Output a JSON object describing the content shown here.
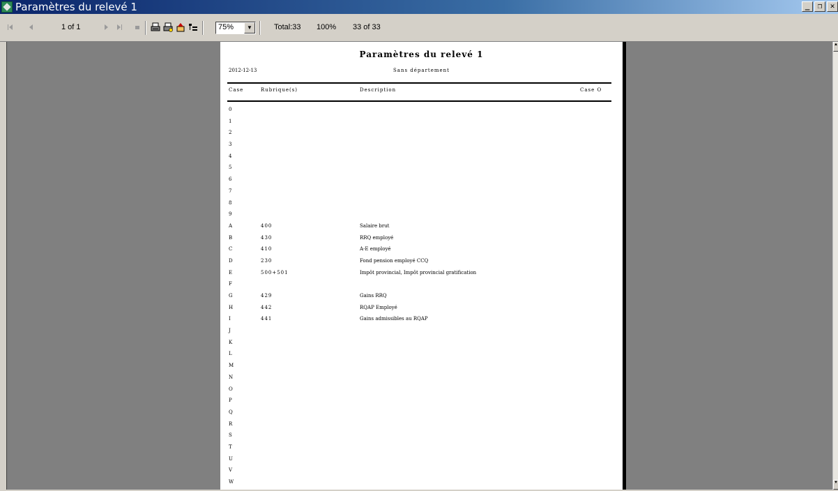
{
  "window": {
    "title": "Paramètres du relevé 1",
    "buttons": [
      "_",
      "❐",
      "✕"
    ]
  },
  "toolbar": {
    "page_indicator": "1 of 1",
    "zoom": "75%",
    "total": "Total:33",
    "percent": "100%",
    "count": "33 of 33"
  },
  "report": {
    "title": "Paramètres du relevé 1",
    "date": "2012-12-13",
    "department": "Sans département",
    "headers": {
      "case": "Case",
      "rubrique": "Rubrique(s)",
      "description": "Description",
      "case0": "Case O"
    },
    "rows": [
      {
        "case": "0",
        "rubrique": "",
        "description": ""
      },
      {
        "case": "1",
        "rubrique": "",
        "description": ""
      },
      {
        "case": "2",
        "rubrique": "",
        "description": ""
      },
      {
        "case": "3",
        "rubrique": "",
        "description": ""
      },
      {
        "case": "4",
        "rubrique": "",
        "description": ""
      },
      {
        "case": "5",
        "rubrique": "",
        "description": ""
      },
      {
        "case": "6",
        "rubrique": "",
        "description": ""
      },
      {
        "case": "7",
        "rubrique": "",
        "description": ""
      },
      {
        "case": "8",
        "rubrique": "",
        "description": ""
      },
      {
        "case": "9",
        "rubrique": "",
        "description": ""
      },
      {
        "case": "A",
        "rubrique": "400",
        "description": "Salaire brut"
      },
      {
        "case": "B",
        "rubrique": "430",
        "description": "RRQ employé"
      },
      {
        "case": "C",
        "rubrique": "410",
        "description": "A-E employé"
      },
      {
        "case": "D",
        "rubrique": "230",
        "description": "Fond pension employé CCQ"
      },
      {
        "case": "E",
        "rubrique": "500+501",
        "description": "Impôt provincial, Impôt provincial gratification"
      },
      {
        "case": "F",
        "rubrique": "",
        "description": ""
      },
      {
        "case": "G",
        "rubrique": "429",
        "description": "Gains RRQ"
      },
      {
        "case": "H",
        "rubrique": "442",
        "description": "RQAP Employé"
      },
      {
        "case": "I",
        "rubrique": "441",
        "description": "Gains admissibles au RQAP"
      },
      {
        "case": "J",
        "rubrique": "",
        "description": ""
      },
      {
        "case": "K",
        "rubrique": "",
        "description": ""
      },
      {
        "case": "L",
        "rubrique": "",
        "description": ""
      },
      {
        "case": "M",
        "rubrique": "",
        "description": ""
      },
      {
        "case": "N",
        "rubrique": "",
        "description": ""
      },
      {
        "case": "O",
        "rubrique": "",
        "description": ""
      },
      {
        "case": "P",
        "rubrique": "",
        "description": ""
      },
      {
        "case": "Q",
        "rubrique": "",
        "description": ""
      },
      {
        "case": "R",
        "rubrique": "",
        "description": ""
      },
      {
        "case": "S",
        "rubrique": "",
        "description": ""
      },
      {
        "case": "T",
        "rubrique": "",
        "description": ""
      },
      {
        "case": "U",
        "rubrique": "",
        "description": ""
      },
      {
        "case": "V",
        "rubrique": "",
        "description": ""
      },
      {
        "case": "W",
        "rubrique": "",
        "description": ""
      }
    ]
  }
}
